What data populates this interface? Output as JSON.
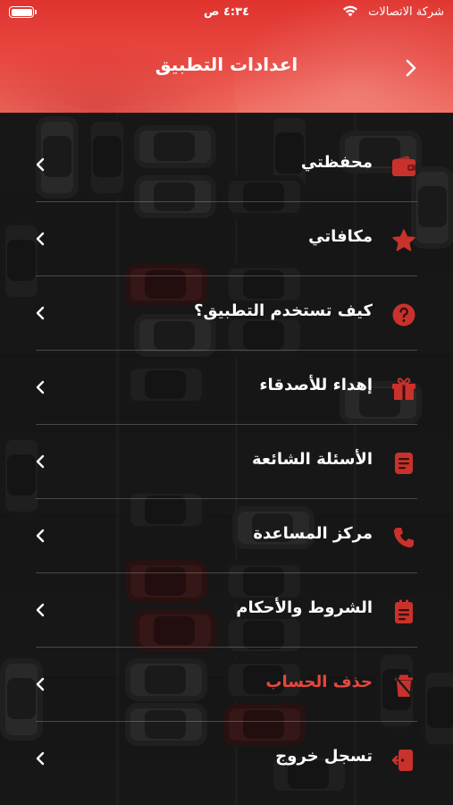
{
  "status_bar": {
    "carrier": "شركة الاتصالات",
    "time": "٤:٣٤ ص"
  },
  "header": {
    "title": "اعدادات التطبيق"
  },
  "colors": {
    "accent": "#e0332e",
    "icon": "#c9322c",
    "danger_text": "#e8483e"
  },
  "menu": {
    "items": [
      {
        "label": "محفظتي",
        "icon": "wallet-icon"
      },
      {
        "label": "مكافاتي",
        "icon": "star-icon"
      },
      {
        "label": "كيف تستخدم التطبيق؟",
        "icon": "question-icon"
      },
      {
        "label": "إهداء للأصدقاء",
        "icon": "gift-icon"
      },
      {
        "label": "الأسئلة الشائعة",
        "icon": "document-icon"
      },
      {
        "label": "مركز المساعدة",
        "icon": "phone-icon"
      },
      {
        "label": "الشروط والأحكام",
        "icon": "clipboard-icon"
      },
      {
        "label": "حذف الحساب",
        "icon": "delete-account-icon",
        "danger": true
      },
      {
        "label": "تسجل خروج",
        "icon": "logout-icon"
      }
    ]
  }
}
